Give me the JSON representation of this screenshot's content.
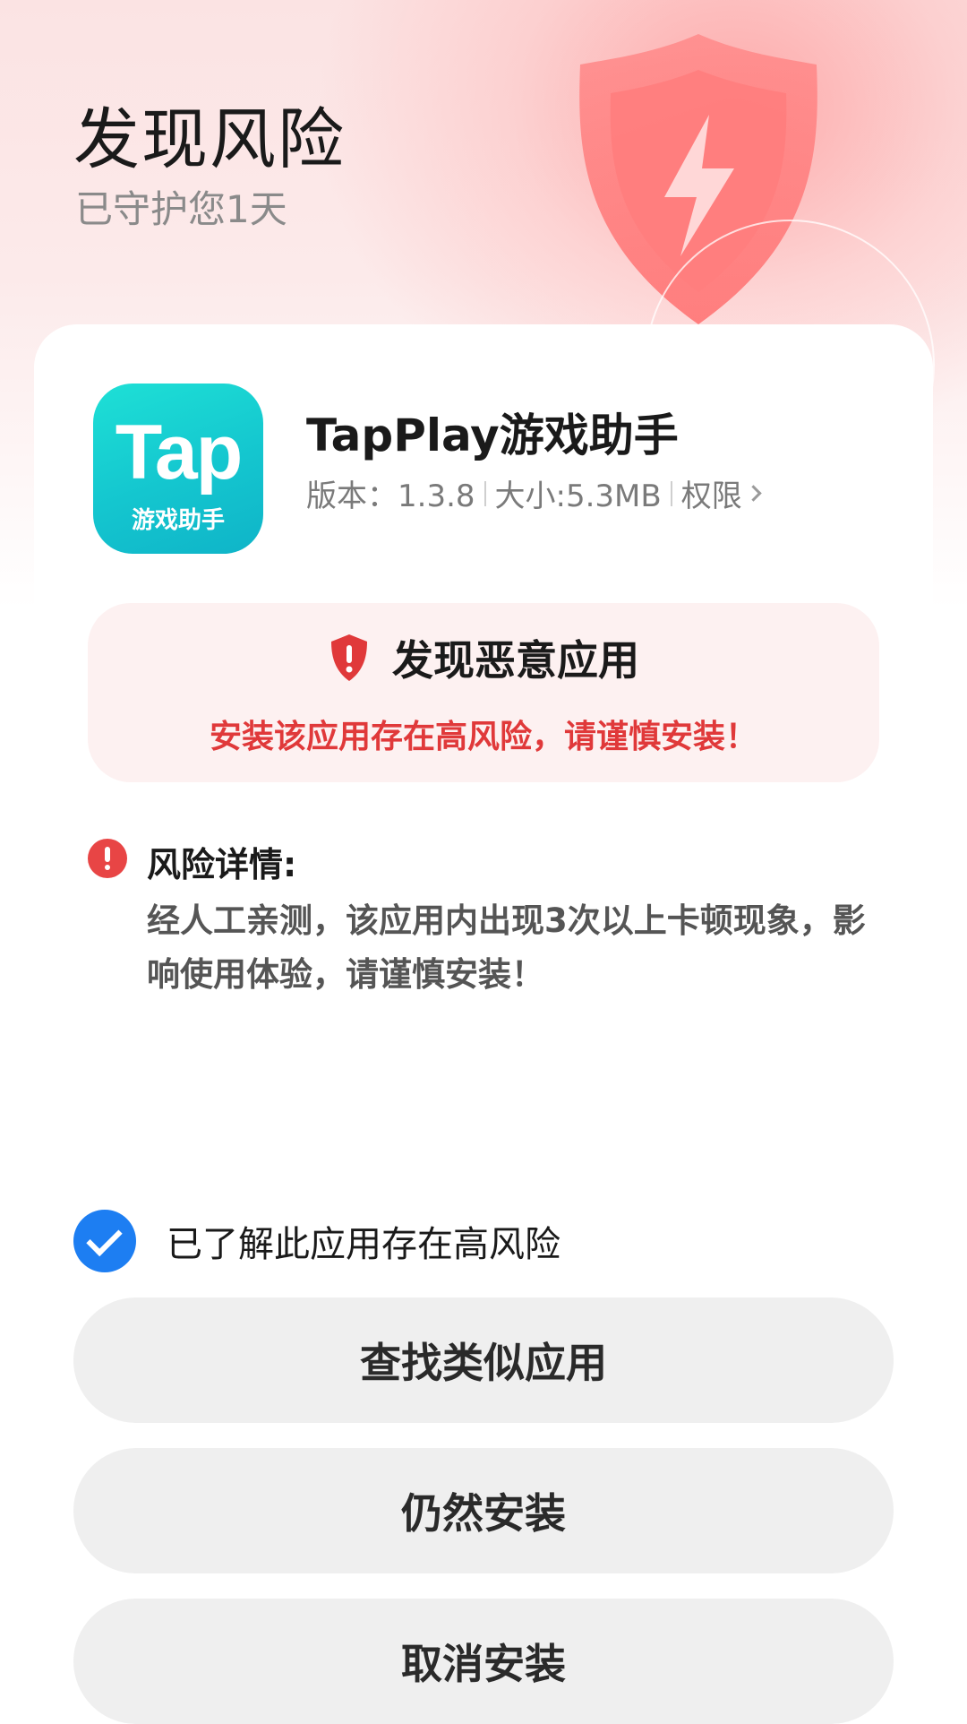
{
  "header": {
    "title": "发现风险",
    "subtitle": "已守护您1天"
  },
  "app": {
    "icon_text_large": "Tap",
    "icon_text_small": "游戏助手",
    "name": "TapPlay游戏助手",
    "version": "版本：1.3.8",
    "size": "大小:5.3MB",
    "permissions_label": "权限"
  },
  "warning": {
    "title": "发现恶意应用",
    "description": "安装该应用存在高风险，请谨慎安装！"
  },
  "risk_detail": {
    "title": "风险详情:",
    "text": "经人工亲测，该应用内出现3次以上卡顿现象，影响使用体验，请谨慎安装！"
  },
  "acknowledge": {
    "label": "已了解此应用存在高风险",
    "checked": true
  },
  "buttons": {
    "find_similar": "查找类似应用",
    "install_anyway": "仍然安装",
    "cancel_install": "取消安装"
  },
  "colors": {
    "danger": "#e0393a",
    "accent_blue": "#1d7ef2",
    "icon_teal": "#14c6cf",
    "button_bg": "#efefef"
  },
  "icons": {
    "hero": "shield-lightning-icon",
    "warning": "shield-alert-icon",
    "detail": "info-alert-icon",
    "check": "checkmark-icon",
    "chevron": "chevron-right-icon"
  }
}
